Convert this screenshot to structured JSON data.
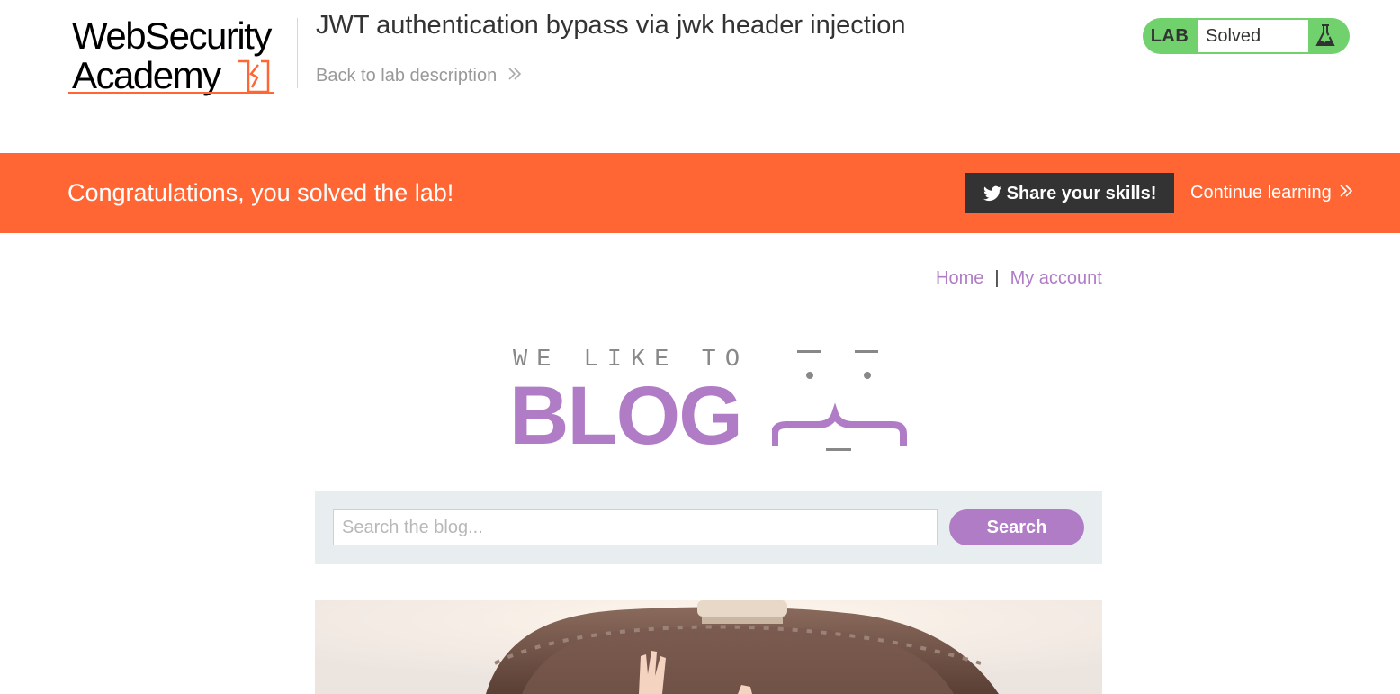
{
  "academy": {
    "logo_line1": "WebSecurity",
    "logo_line2": "Academy",
    "lab_title": "JWT authentication bypass via jwk header injection",
    "back_link": "Back to lab description",
    "status_label": "LAB",
    "status_value": "Solved"
  },
  "banner": {
    "message": "Congratulations, you solved the lab!",
    "share_label": "Share your skills!",
    "continue_label": "Continue learning"
  },
  "nav": {
    "home": "Home",
    "separator": "|",
    "account": "My account"
  },
  "blog": {
    "tagline": "WE LIKE TO",
    "title": "BLOG"
  },
  "search": {
    "placeholder": "Search the blog...",
    "value": "",
    "button": "Search"
  },
  "colors": {
    "brand_orange": "#ff6633",
    "lab_green": "#70d16d",
    "blog_purple": "#b07cc6",
    "share_dark": "#333333"
  }
}
